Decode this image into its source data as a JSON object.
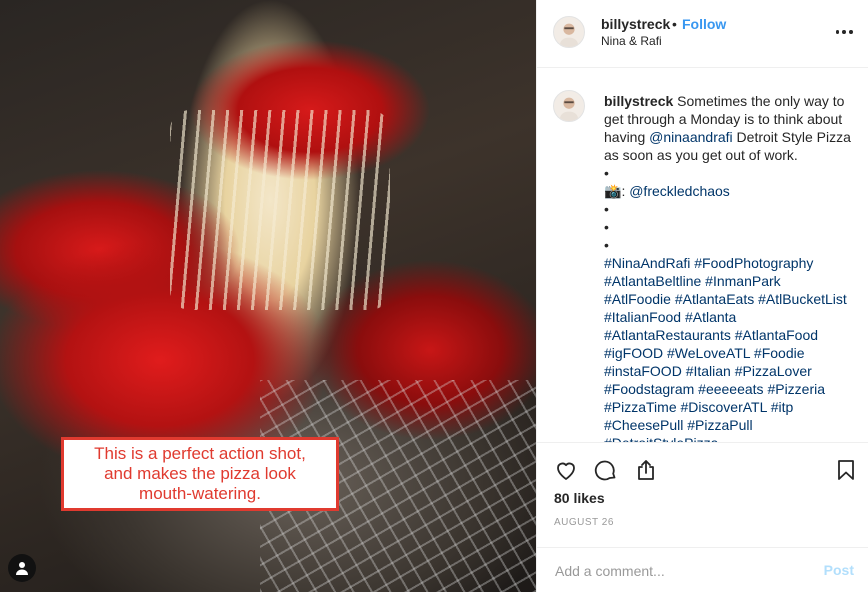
{
  "photo": {
    "annotation_lines": [
      "This is a perfect action shot,",
      "and makes the pizza look",
      "mouth-watering."
    ],
    "annotation_color": "#e03a2f"
  },
  "header": {
    "username": "billystreck",
    "separator": "•",
    "follow_label": "Follow",
    "location": "Nina & Rafi",
    "more_icon": "more-horizontal-icon"
  },
  "caption": {
    "username": "billystreck",
    "text_before_mention": "Sometimes the only way to get through a Monday is to think about having",
    "mention": "@ninaandrafi",
    "text_after_mention": "Detroit Style Pizza as soon as you get out of work.",
    "bullet": "•",
    "camera_emoji": "📸",
    "credit_prefix": ":",
    "credit_mention": "@freckledchaos",
    "hashtag_lines": [
      "#NinaAndRafi #FoodPhotography",
      "#AtlantaBeltline #InmanPark",
      "#AtlFoodie #AtlantaEats #AtlBucketList",
      "#ItalianFood #Atlanta",
      "#AtlantaRestaurants #AtlantaFood",
      "#igFOOD #WeLoveATL #Foodie",
      "#instaFOOD #Italian #PizzaLover",
      "#Foodstagram #eeeeeats #Pizzeria",
      "#PizzaTime #DiscoverATL #itp",
      "#CheesePull #PizzaPull",
      "#DetroitStylePizza"
    ]
  },
  "actions": {
    "like_icon": "heart-icon",
    "comment_icon": "comment-icon",
    "share_icon": "share-icon",
    "save_icon": "bookmark-icon",
    "likes_text": "80 likes",
    "date": "AUGUST 26"
  },
  "comment_form": {
    "placeholder": "Add a comment...",
    "post_label": "Post",
    "post_color": "#b2dffc"
  },
  "colors": {
    "link": "#3897f0",
    "hashtag": "#003569",
    "text": "#262626",
    "muted": "#999999"
  }
}
